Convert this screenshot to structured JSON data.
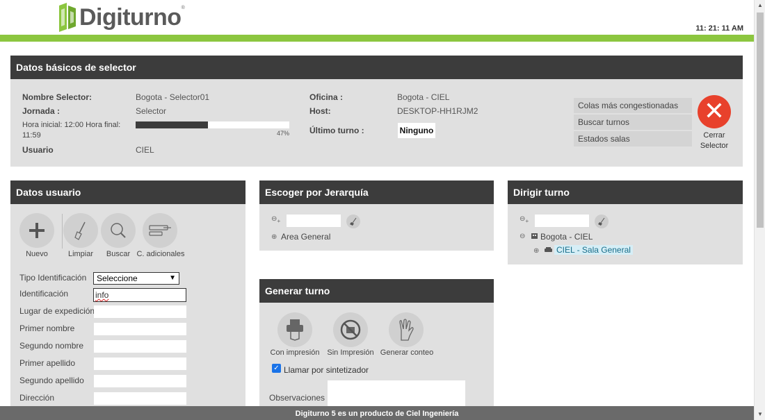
{
  "header": {
    "logo_text": "Digiturno",
    "logo_reg": "®",
    "clock": "11: 21: 11 AM"
  },
  "basic": {
    "title": "Datos básicos de selector",
    "nombre_label": "Nombre Selector:",
    "nombre_value": "Bogota - Selector01",
    "jornada_label": "Jornada :",
    "jornada_value": "Selector",
    "hora_label": "Hora inicial: 12:00 Hora final: 11:59",
    "progress": 0.47,
    "progress_label": "47%",
    "usuario_label": "Usuario",
    "usuario_value": "CIEL",
    "oficina_label": "Oficina :",
    "oficina_value": "Bogota - CIEL",
    "host_label": "Host:",
    "host_value": "DESKTOP-HH1RJM2",
    "ultimo_label": "Último turno :",
    "ultimo_value": "Ninguno",
    "side_buttons": [
      "Colas más congestionadas",
      "Buscar turnos",
      "Estados salas"
    ],
    "close_label": "Cerrar Selector"
  },
  "usuario": {
    "title": "Datos usuario",
    "tools": [
      "Nuevo",
      "Limpiar",
      "Buscar",
      "C. adicionales"
    ],
    "fields": {
      "tipo": "Tipo Identificación",
      "identificacion": "Identificación",
      "lugar": "Lugar de expedición",
      "primer_nombre": "Primer nombre",
      "segundo_nombre": "Segundo nombre",
      "primer_apellido": "Primer apellido",
      "segundo_apellido": "Segundo apellido",
      "direccion": "Dirección"
    },
    "tipo_selected": "Seleccione",
    "identificacion_value": "info"
  },
  "jerarquia": {
    "title": "Escoger por Jerarquía",
    "item": "Area General"
  },
  "generar": {
    "title": "Generar turno",
    "tools": [
      "Con impresión",
      "Sin Impresión",
      "Generar conteo"
    ],
    "checkbox_label": "Llamar por sintetizador",
    "obs_label": "Observaciones :"
  },
  "dirigir": {
    "title": "Dirigir turno",
    "parent": "Bogota - CIEL",
    "child": "CIEL - Sala General"
  },
  "footer": {
    "text": "Digiturno 5 es un producto de Ciel Ingeniería"
  },
  "colors": {
    "accent_green": "#8cc63f",
    "panel_dark": "#3c3c3c",
    "close_red": "#e8412c"
  }
}
